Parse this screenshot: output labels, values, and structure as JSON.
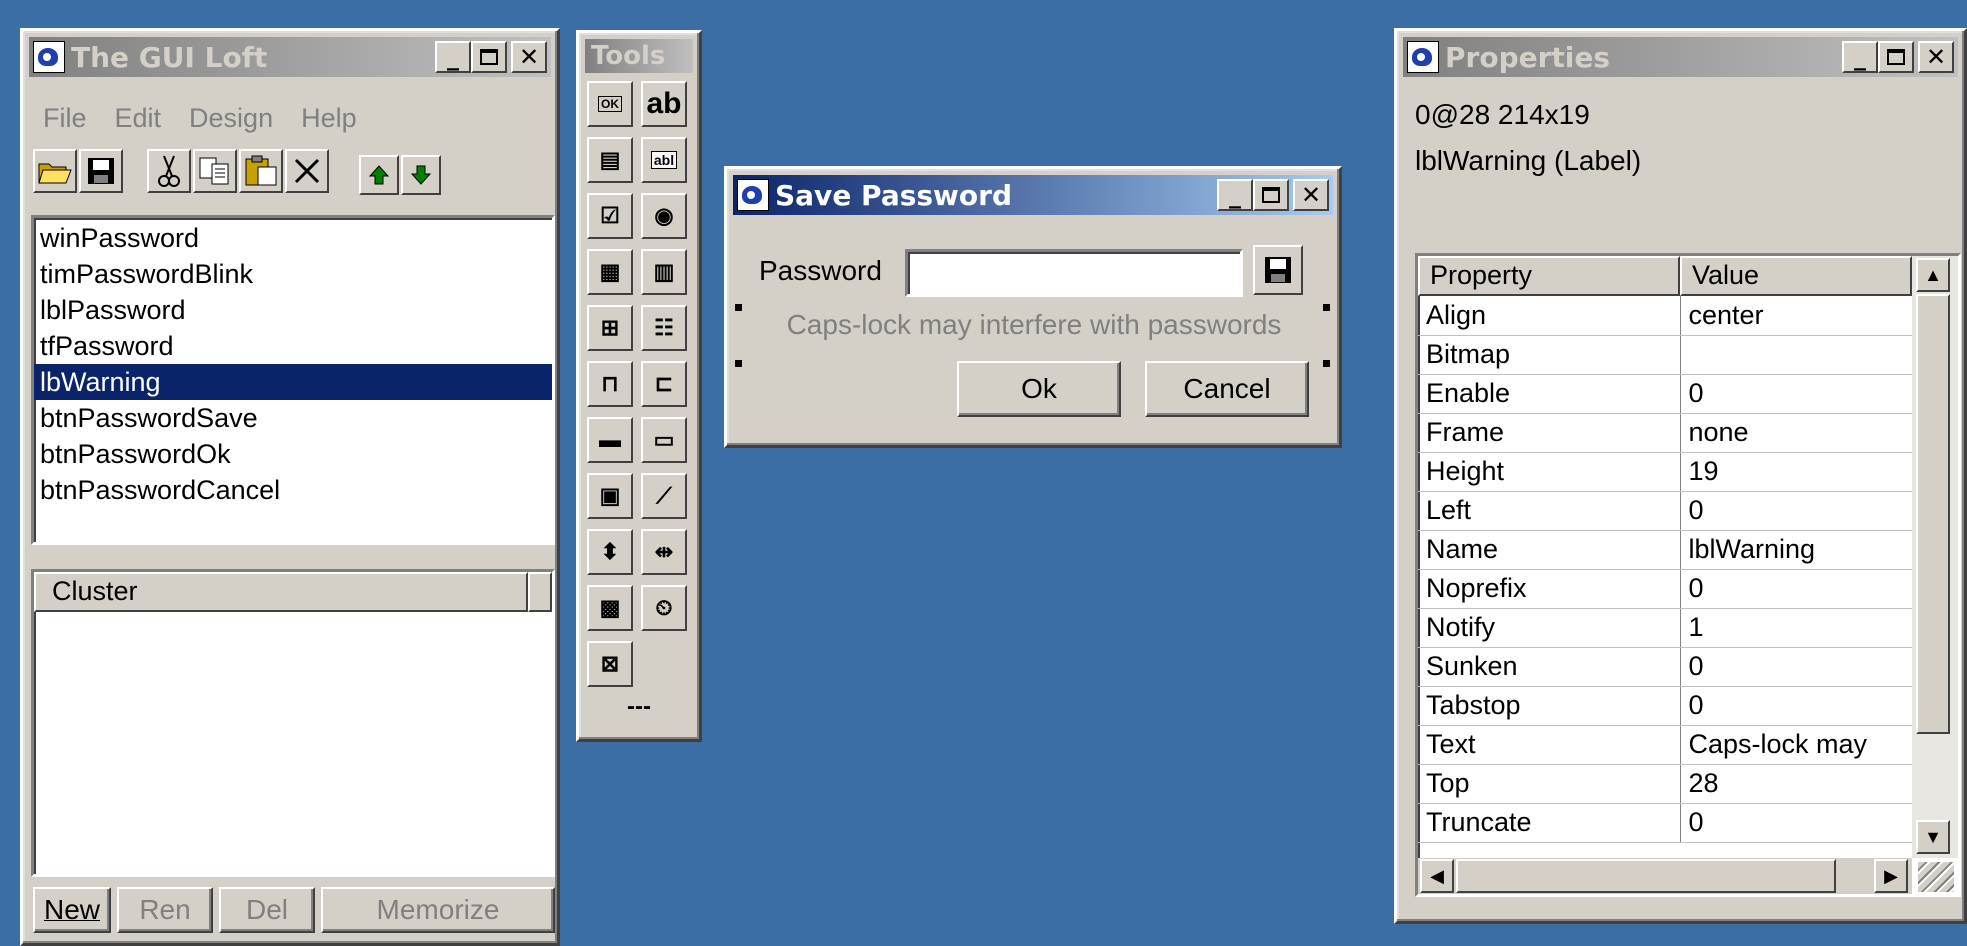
{
  "colors": {
    "desktop": "#3a6ea5",
    "active_title": "#0a246a",
    "inactive_title": "#808080",
    "face": "#d4d0c8",
    "selection": "#0a246a"
  },
  "loft": {
    "title": "The GUI Loft",
    "menu": [
      "File",
      "Edit",
      "Design",
      "Help"
    ],
    "toolbar_icons": [
      "open-folder-icon",
      "save-disk-icon",
      "cut-scissors-icon",
      "copy-icon",
      "paste-icon",
      "delete-x-icon",
      "move-up-arrow-icon",
      "move-down-arrow-icon"
    ],
    "controls": [
      "winPassword",
      "timPasswordBlink",
      "lblPassword",
      "tfPassword",
      "lbWarning",
      "btnPasswordSave",
      "btnPasswordOk",
      "btnPasswordCancel"
    ],
    "selected": "lbWarning",
    "cluster_header": "Cluster",
    "buttons": {
      "new": "New",
      "ren": "Ren",
      "del": "Del",
      "memorize": "Memorize"
    }
  },
  "tools": {
    "title": "Tools",
    "items": [
      "button-tool-icon",
      "text-label-tool-icon",
      "listbox-tool-icon",
      "textfield-tool-icon",
      "checkbox-tool-icon",
      "radio-tool-icon",
      "grid-tool-icon",
      "listview-tool-icon",
      "treeview-tool-icon",
      "table-tool-icon",
      "tab-tool-icon",
      "tab2-tool-icon",
      "progress-tool-icon",
      "statusbar-tool-icon",
      "image-tool-icon",
      "line-tool-icon",
      "updown-tool-icon",
      "splitter-tool-icon",
      "custom-tool-icon",
      "timer-tool-icon",
      "frame-tool-icon"
    ],
    "more": "---"
  },
  "dialog": {
    "title": "Save Password",
    "password_label": "Password",
    "password_value": "",
    "warning": "Caps-lock may interfere with passwords",
    "ok": "Ok",
    "cancel": "Cancel"
  },
  "properties": {
    "title": "Properties",
    "geometry": "0@28 214x19",
    "selected_name": "lblWarning (Label)",
    "col_property": "Property",
    "col_value": "Value",
    "rows": [
      {
        "k": "Align",
        "v": "center"
      },
      {
        "k": "Bitmap",
        "v": ""
      },
      {
        "k": "Enable",
        "v": "0"
      },
      {
        "k": "Frame",
        "v": "none"
      },
      {
        "k": "Height",
        "v": "19"
      },
      {
        "k": "Left",
        "v": "0"
      },
      {
        "k": "Name",
        "v": "lblWarning"
      },
      {
        "k": "Noprefix",
        "v": "0"
      },
      {
        "k": "Notify",
        "v": "1"
      },
      {
        "k": "Sunken",
        "v": "0"
      },
      {
        "k": "Tabstop",
        "v": "0"
      },
      {
        "k": "Text",
        "v": "Caps-lock may"
      },
      {
        "k": "Top",
        "v": "28"
      },
      {
        "k": "Truncate",
        "v": "0"
      }
    ]
  }
}
